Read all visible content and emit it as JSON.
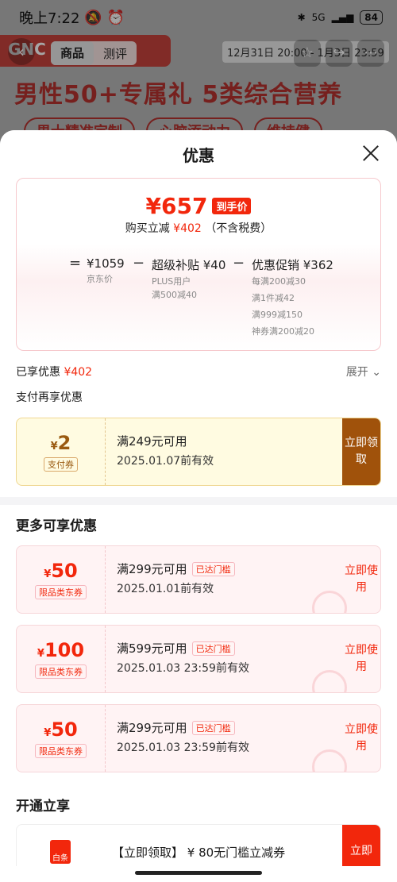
{
  "status_bar": {
    "time": "晚上7:22",
    "network": "5G",
    "battery": "84"
  },
  "background_page": {
    "brand": "GNC",
    "tabs": [
      "商品",
      "测评"
    ],
    "date_range": "12月31日 20:00 - 1月3日 23:59",
    "headline": "男性50+专属礼 5类综合营养",
    "pills": [
      "男士精准定制",
      "心脑添动力",
      "维持健"
    ]
  },
  "sheet": {
    "title": "优惠",
    "price": "¥657",
    "price_tag": "到手价",
    "buy_reduce_label": "购买立减",
    "buy_reduce_amount": "¥402",
    "buy_reduce_note": "（不含税费）",
    "formula": {
      "eq": "=",
      "minus": "−",
      "jd_price": "¥1059",
      "jd_price_label": "京东价",
      "super_subsidy": "超级补贴 ¥40",
      "super_subsidy_lines": [
        "PLUS用户",
        "满500减40"
      ],
      "promo": "优惠促销 ¥362",
      "promo_lines": [
        "每满200减30",
        "满1件减42",
        "满999减150",
        "神券满200减20"
      ]
    },
    "enjoyed_label": "已享优惠",
    "enjoyed_amount": "¥402",
    "expand_label": "展开",
    "pay_more_title": "支付再享优惠",
    "pay_coupon": {
      "currency": "¥",
      "amount": "2",
      "tag": "支付券",
      "condition": "满249元可用",
      "expiry": "2025.01.07前有效",
      "button": "立即领取"
    },
    "more_title": "更多可享优惠",
    "more_coupons": [
      {
        "currency": "¥",
        "amount": "50",
        "tag": "限品类东券",
        "condition": "满299元可用",
        "badge": "已达门槛",
        "expiry": "2025.01.01前有效",
        "button": "立即使用"
      },
      {
        "currency": "¥",
        "amount": "100",
        "tag": "限品类东券",
        "condition": "满599元可用",
        "badge": "已达门槛",
        "expiry": "2025.01.03 23:59前有效",
        "button": "立即使用"
      },
      {
        "currency": "¥",
        "amount": "50",
        "tag": "限品类东券",
        "condition": "满299元可用",
        "badge": "已达门槛",
        "expiry": "2025.01.03 23:59前有效",
        "button": "立即使用"
      }
    ],
    "open_title": "开通立享",
    "open_card": {
      "icon_label": "白条",
      "text": "【立即领取】 ¥ 80无门槛立减券",
      "button": "立即"
    }
  }
}
